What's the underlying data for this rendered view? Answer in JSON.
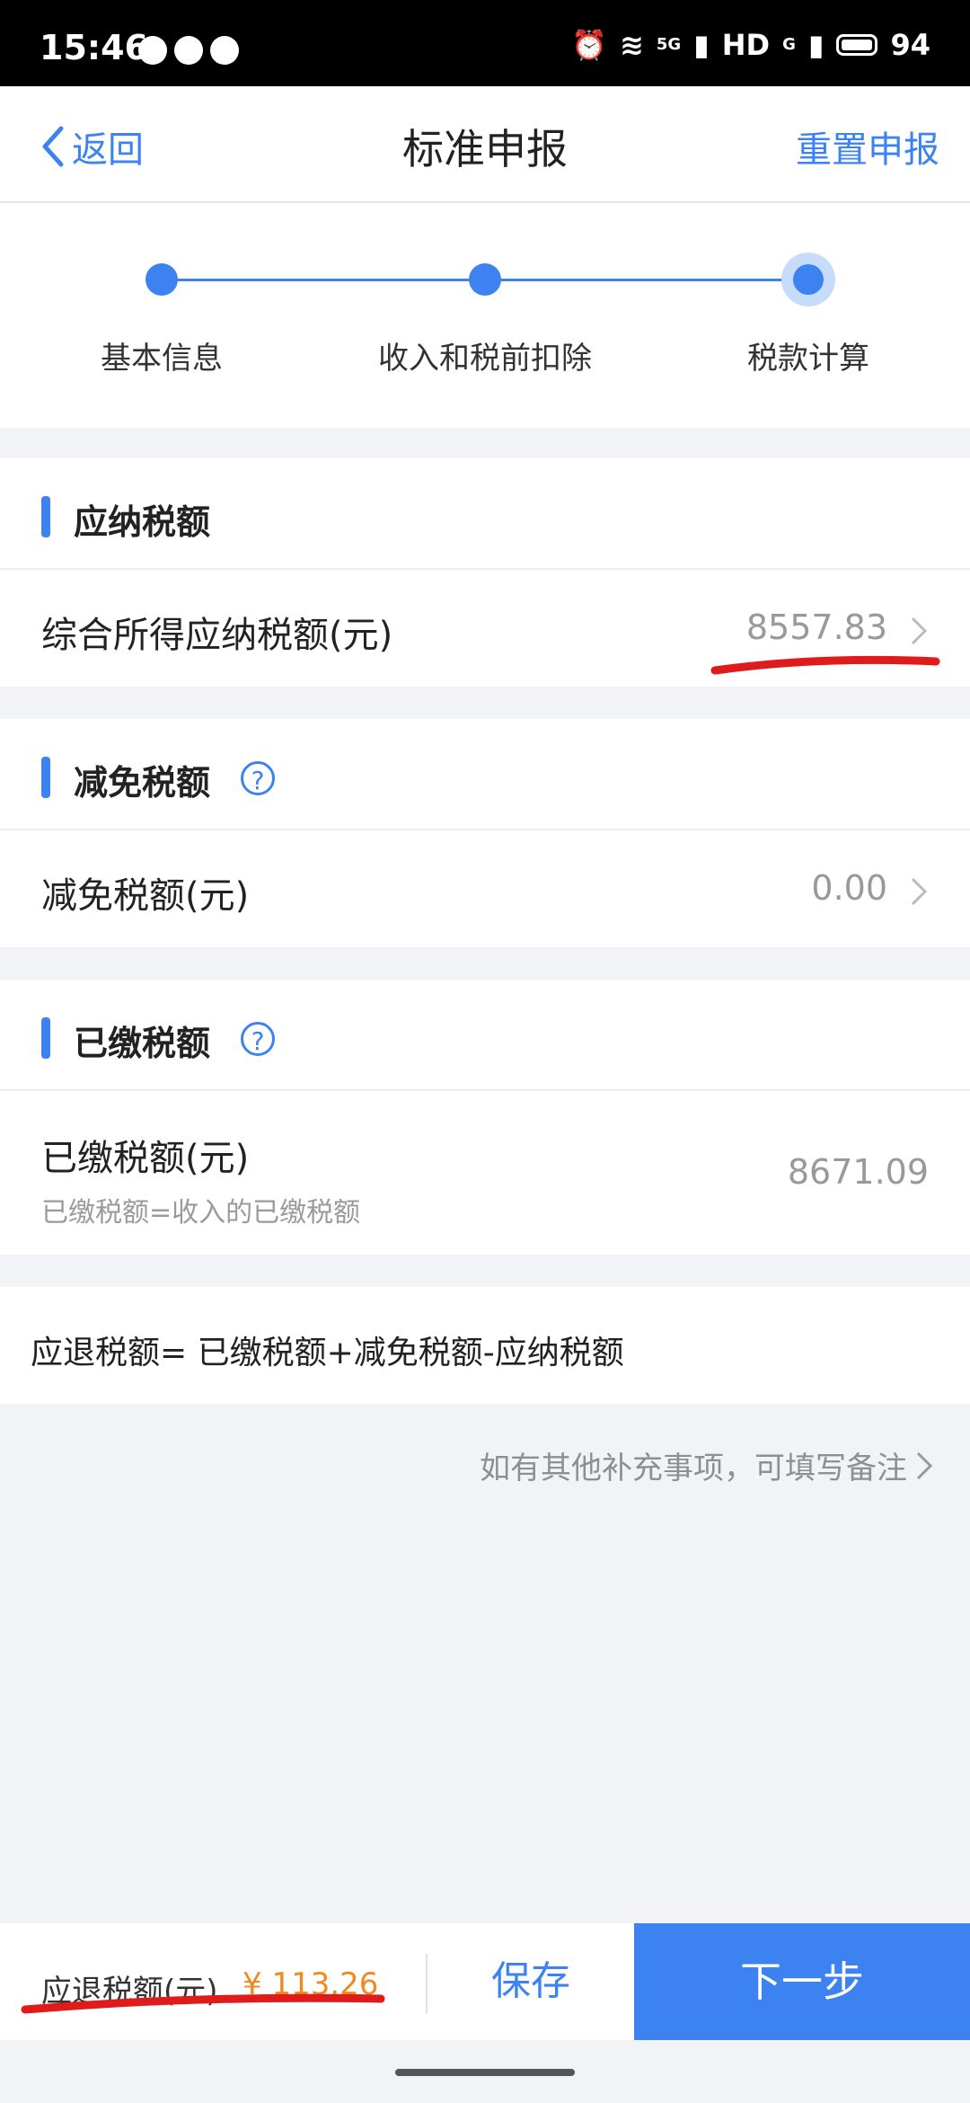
{
  "status_bar": {
    "time": "15:46",
    "network": "5G",
    "hd": "HD",
    "signal2": "G",
    "battery": "94"
  },
  "nav": {
    "back_label": "返回",
    "title": "标准申报",
    "reset_label": "重置申报"
  },
  "steps": [
    {
      "label": "基本信息",
      "state": "done"
    },
    {
      "label": "收入和税前扣除",
      "state": "done"
    },
    {
      "label": "税款计算",
      "state": "active"
    }
  ],
  "sections": {
    "payable": {
      "title": "应纳税额",
      "row_label": "综合所得应纳税额(元)",
      "row_value": "8557.83"
    },
    "reduction": {
      "title": "减免税额",
      "row_label": "减免税额(元)",
      "row_value": "0.00"
    },
    "paid": {
      "title": "已缴税额",
      "row_label": "已缴税额(元)",
      "row_sublabel": "已缴税额=收入的已缴税额",
      "row_value": "8671.09"
    }
  },
  "formula": "应退税额= 已缴税额+减免税额-应纳税额",
  "note_link": "如有其他补充事项，可填写备注",
  "bottom": {
    "refund_label": "应退税额(元)",
    "refund_amount": "¥ 113.26",
    "save_label": "保存",
    "next_label": "下一步"
  },
  "colors": {
    "accent": "#3c82f0",
    "refund": "#f0891f",
    "annotation": "#e01b1b"
  }
}
